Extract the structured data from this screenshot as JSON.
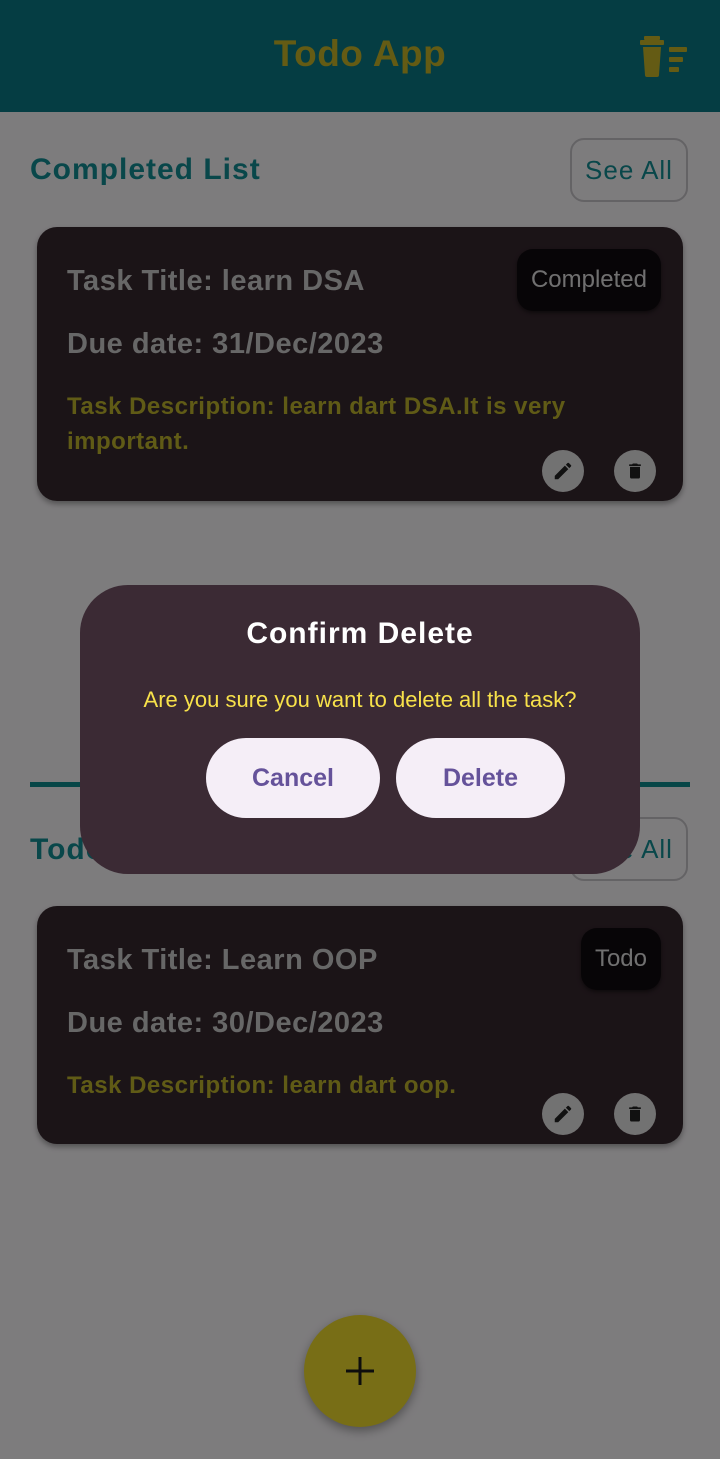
{
  "app": {
    "title": "Todo App",
    "delete_all_icon": "delete-sweep-icon"
  },
  "completed_section": {
    "title": "Completed List",
    "see_all": "See All",
    "task": {
      "title": "Task Title: learn DSA",
      "due": "Due date: 31/Dec/2023",
      "description": "Task Description: learn dart DSA.It is very important.",
      "status": "Completed"
    }
  },
  "todo_section": {
    "title": "Todo",
    "see_all": "See All",
    "task": {
      "title": "Task Title: Learn OOP",
      "due": "Due date: 30/Dec/2023",
      "description": "Task Description: learn dart oop.",
      "status": "Todo"
    }
  },
  "fab": {
    "icon": "plus-icon"
  },
  "dialog": {
    "title": "Confirm Delete",
    "message": "Are you sure you want to delete all the task?",
    "cancel": "Cancel",
    "delete": "Delete"
  },
  "colors": {
    "appbar": "#0a7b86",
    "accent_yellow": "#c8b729",
    "teal": "#128f95",
    "card": "#37282f",
    "dialog": "#3b2a34"
  }
}
